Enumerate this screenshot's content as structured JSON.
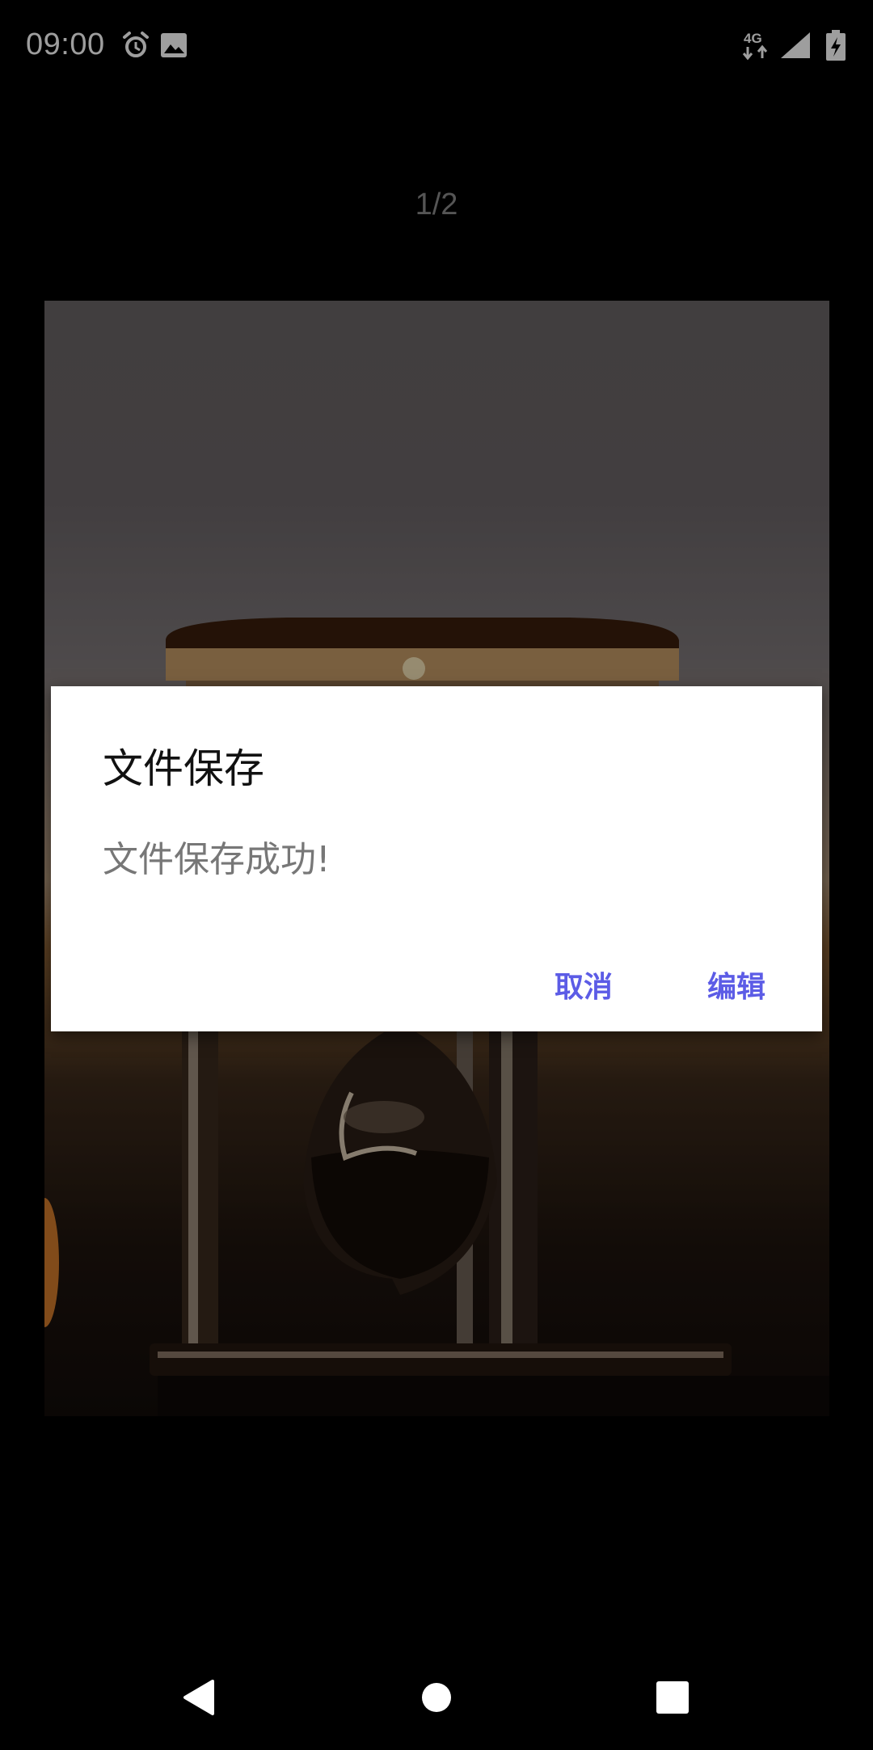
{
  "status_bar": {
    "time": "09:00",
    "left_icons": [
      "alarm-icon",
      "image-notification-icon"
    ],
    "network_label": "4G",
    "right_icons": [
      "network-4g-icon",
      "signal-icon",
      "battery-charging-icon"
    ]
  },
  "viewer": {
    "page_indicator": "1/2",
    "image": "hourglass-photo"
  },
  "dialog": {
    "title": "文件保存",
    "message": "文件保存成功!",
    "cancel_label": "取消",
    "edit_label": "编辑",
    "button_color": "#5c5ce6"
  },
  "nav_bar": {
    "icons": [
      "back-icon",
      "home-icon",
      "recents-icon"
    ]
  }
}
